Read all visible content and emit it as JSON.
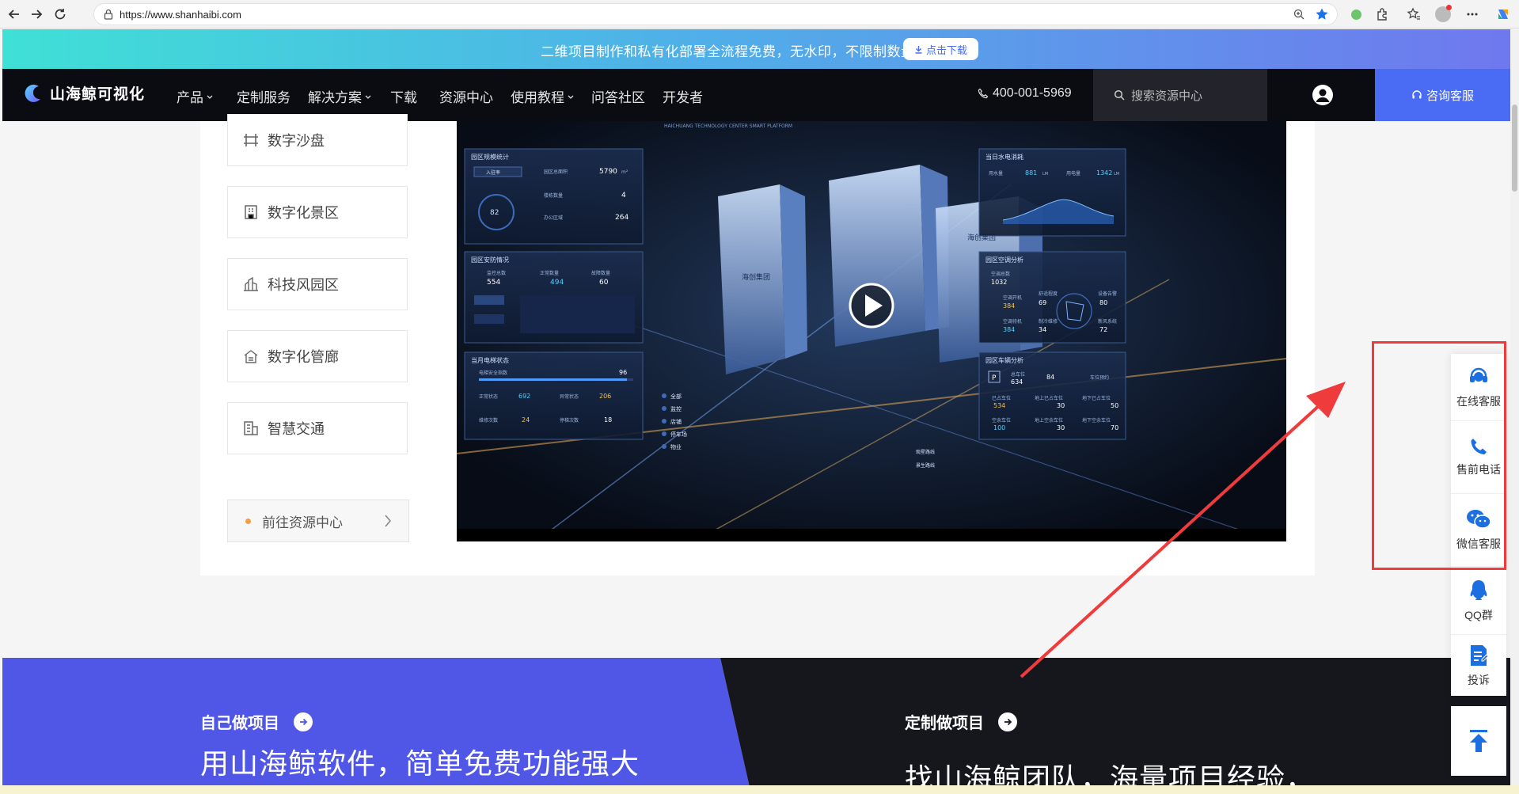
{
  "browser": {
    "url": "https://www.shanhaibi.com"
  },
  "promo": {
    "text": "二维项目制作和私有化部署全流程免费，无水印，不限制数量",
    "button_label": "点击下载"
  },
  "header": {
    "logo_text": "山海鲸可视化",
    "nav": [
      {
        "label": "产品",
        "dropdown": true
      },
      {
        "label": "定制服务",
        "dropdown": false
      },
      {
        "label": "解决方案",
        "dropdown": true
      },
      {
        "label": "下载",
        "dropdown": false
      },
      {
        "label": "资源中心",
        "dropdown": false
      },
      {
        "label": "使用教程",
        "dropdown": true
      },
      {
        "label": "问答社区",
        "dropdown": false
      },
      {
        "label": "开发者",
        "dropdown": false
      }
    ],
    "phone": "400-001-5969",
    "search_placeholder": "搜索资源中心",
    "consult_label": "咨询客服"
  },
  "sidebar": {
    "items": [
      {
        "label": "数字沙盘",
        "icon": "sandbox-icon"
      },
      {
        "label": "数字化景区",
        "icon": "scenic-icon"
      },
      {
        "label": "科技风园区",
        "icon": "park-icon"
      },
      {
        "label": "数字化管廊",
        "icon": "pipe-gallery-icon"
      },
      {
        "label": "智慧交通",
        "icon": "traffic-icon"
      }
    ],
    "link_label": "前往资源中心"
  },
  "video": {
    "header": "HAICHUANG TECHNOLOGY CENTER SMART PLATFORM",
    "panels": {
      "stats_title": "园区规模统计",
      "stats_area": "5790",
      "stats_area_unit": "m²",
      "stats_building": "4",
      "stats_office": "264",
      "stats_rate": "82",
      "stats_tag": "入驻率",
      "stats_label_area": "园区总面积",
      "stats_label_building": "楼栋数量",
      "stats_label_office": "办公区域",
      "security_title": "园区安防情况",
      "security_total": "554",
      "security_normal": "494",
      "security_fault": "60",
      "security_label_total": "监控总数",
      "security_label_normal": "正常数量",
      "security_label_fault": "故障数量",
      "elevator_title": "当月电梯状态",
      "elevator_safe": "96",
      "elevator_label_safe": "电梯安全指数",
      "elevator_normal": "692",
      "elevator_label_normal": "正常状态",
      "elevator_abnormal": "206",
      "elevator_label_abnormal": "异常状态",
      "elevator_repair": "24",
      "elevator_label_repair": "维修次数",
      "elevator_stop": "18",
      "elevator_label_stop": "停梯次数",
      "water_title": "当日水电消耗",
      "water_value": "881",
      "water_unit": "LM",
      "power_value": "1342",
      "power_unit": "LM",
      "water_label": "用水量",
      "power_label": "用电量",
      "ac_title": "园区空调分析",
      "ac_total": "1032",
      "ac_on": "384",
      "ac_off": "384",
      "ac_label_total": "空调总数",
      "ac_label_on": "空调开机",
      "ac_label_off": "空调待机",
      "ac_comfort": "69",
      "ac_label_comfort": "舒适程度",
      "ac_repair": "34",
      "ac_label_repair": "制冷维修",
      "ac_device": "80",
      "ac_label_device": "设备告警",
      "ac_new": "72",
      "ac_label_new": "新风系统",
      "car_title": "园区车辆分析",
      "car_total": "634",
      "car_label_total": "总车位",
      "car_rate": "84",
      "car_used": "534",
      "car_label_used": "已占车位",
      "car_ground": "30",
      "car_label_ground": "地上已占车位",
      "car_under": "50",
      "car_label_under": "地下已占车位",
      "car_free": "100",
      "car_label_free": "空余车位",
      "car_gfree": "30",
      "car_label_gfree": "地上空余车位",
      "car_ufree": "70",
      "car_label_ufree": "地下空余车位",
      "car_tag": "车位预约"
    },
    "menu": [
      "全部",
      "监控",
      "店铺",
      "停车场",
      "物业"
    ],
    "building_labels": [
      "海创集团",
      "海创集团"
    ],
    "road_labels": [
      "观星路线",
      "景生路线"
    ],
    "chart_ticks_y": [
      "300",
      "225",
      "150",
      "75",
      "0"
    ],
    "chart_ticks_y2": [
      "300",
      "240",
      "180",
      "120",
      "60",
      "0"
    ],
    "chart_ticks_x": [
      "06:00",
      "08:00",
      "10:00",
      "12:00",
      "14:00",
      "16:00",
      "18:00"
    ]
  },
  "bottom": {
    "left_tag": "自己做项目",
    "left_title": "用山海鲸软件，简单免费功能强大",
    "right_tag": "定制做项目",
    "right_title": "找山海鲸团队，海量项目经验，"
  },
  "float": {
    "items": [
      {
        "label": "在线客服",
        "icon": "headset-icon"
      },
      {
        "label": "售前电话",
        "icon": "phone-icon"
      },
      {
        "label": "微信客服",
        "icon": "wechat-icon"
      },
      {
        "label": "QQ群",
        "icon": "qq-icon"
      },
      {
        "label": "投诉",
        "icon": "complaint-icon"
      }
    ]
  },
  "colors": {
    "accent": "#4a6cf5",
    "highlight": "#ef3b3b",
    "float_icon": "#1b6fe0"
  }
}
